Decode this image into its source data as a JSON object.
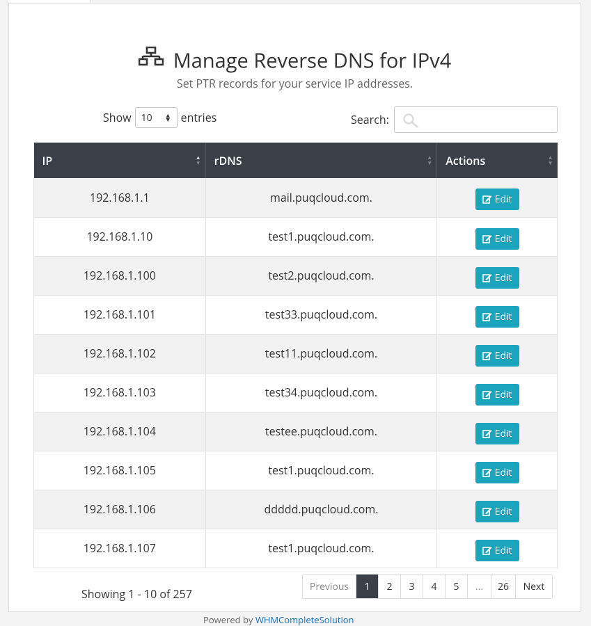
{
  "header": {
    "title": "Manage Reverse DNS for IPv4",
    "subtitle": "Set PTR records for your service IP addresses."
  },
  "controls": {
    "show_label": "Show",
    "entries_value": "10",
    "entries_label": "entries",
    "search_label": "Search:",
    "search_value": ""
  },
  "table": {
    "columns": [
      "IP",
      "rDNS",
      "Actions"
    ],
    "rows": [
      {
        "ip": "192.168.1.1",
        "rdns": "mail.puqcloud.com.",
        "action": "Edit"
      },
      {
        "ip": "192.168.1.10",
        "rdns": "test1.puqcloud.com.",
        "action": "Edit"
      },
      {
        "ip": "192.168.1.100",
        "rdns": "test2.puqcloud.com.",
        "action": "Edit"
      },
      {
        "ip": "192.168.1.101",
        "rdns": "test33.puqcloud.com.",
        "action": "Edit"
      },
      {
        "ip": "192.168.1.102",
        "rdns": "test11.puqcloud.com.",
        "action": "Edit"
      },
      {
        "ip": "192.168.1.103",
        "rdns": "test34.puqcloud.com.",
        "action": "Edit"
      },
      {
        "ip": "192.168.1.104",
        "rdns": "testee.puqcloud.com.",
        "action": "Edit"
      },
      {
        "ip": "192.168.1.105",
        "rdns": "test1.puqcloud.com.",
        "action": "Edit"
      },
      {
        "ip": "192.168.1.106",
        "rdns": "ddddd.puqcloud.com.",
        "action": "Edit"
      },
      {
        "ip": "192.168.1.107",
        "rdns": "test1.puqcloud.com.",
        "action": "Edit"
      }
    ]
  },
  "info": "Showing 1 - 10 of 257",
  "pagination": {
    "previous": "Previous",
    "pages": [
      "1",
      "2",
      "3",
      "4",
      "5",
      "...",
      "26"
    ],
    "active": "1",
    "next": "Next"
  },
  "footer": {
    "prefix": "Powered by ",
    "link": "WHMCompleteSolution"
  },
  "colors": {
    "header_bg": "#3a3f48",
    "edit_button": "#1aa4bd",
    "link": "#1a6fb5"
  }
}
